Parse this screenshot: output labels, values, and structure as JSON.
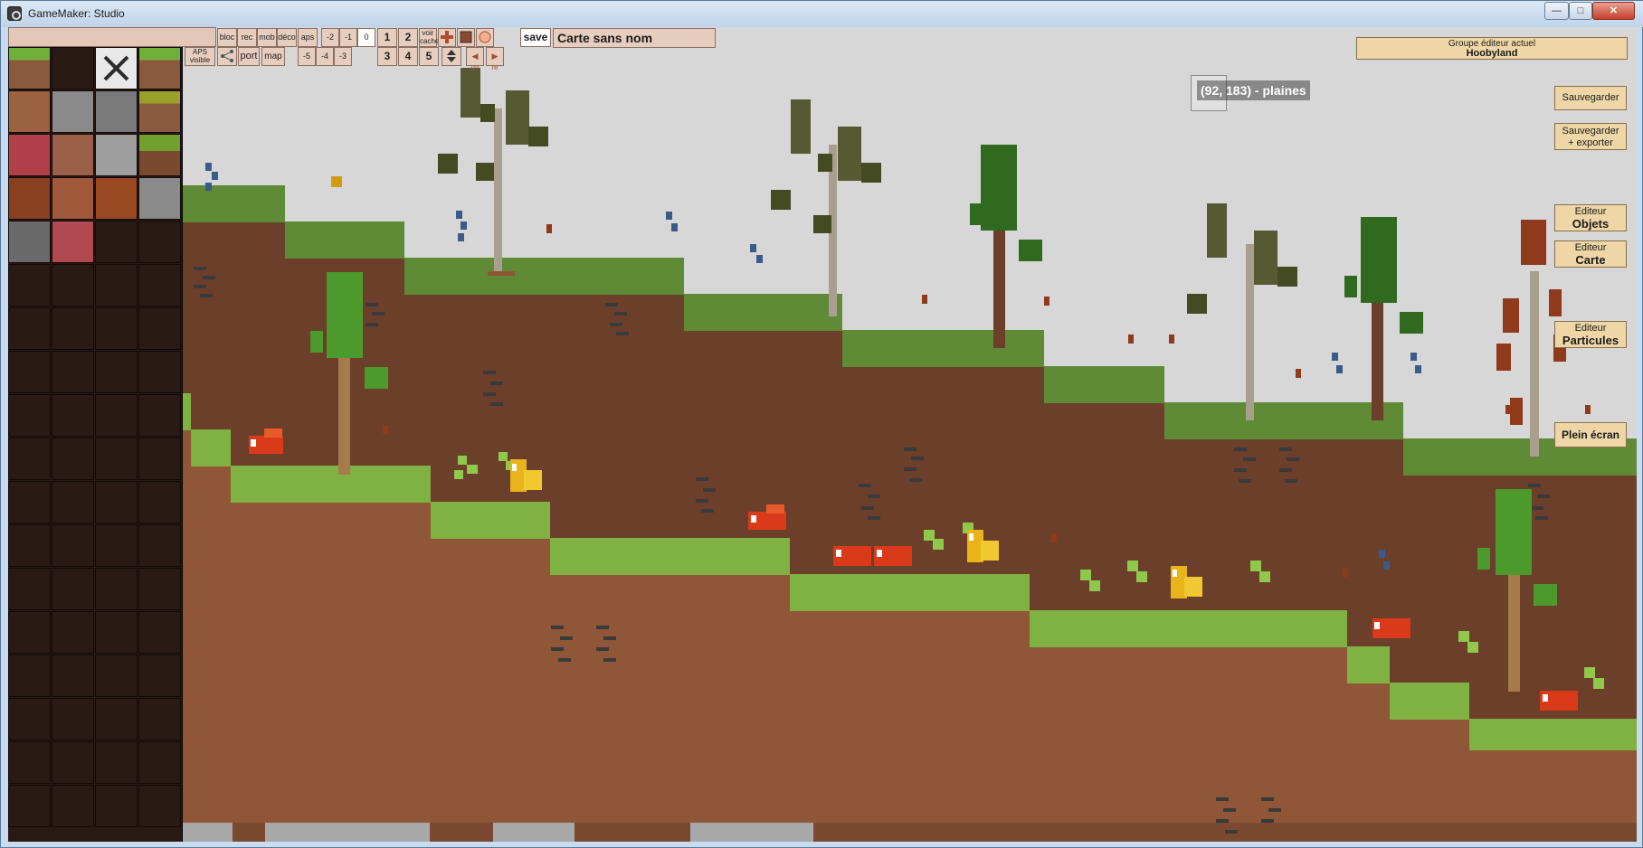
{
  "window": {
    "title": "GameMaker: Studio",
    "controls": {
      "minimize": "—",
      "maximize": "□",
      "close": "✕"
    }
  },
  "toolbar": {
    "row1": [
      "bloc",
      "rec",
      "mob",
      "déco",
      "aps",
      "-2",
      "-1",
      "0",
      "1",
      "2",
      "voir cache"
    ],
    "row2": [
      "APS visible",
      "port",
      "map",
      "-5",
      "-4",
      "-3",
      "3",
      "4",
      "5",
      "un",
      "re"
    ],
    "save": "save",
    "map_name": "Carte sans nom",
    "icons": [
      "dpad-icon",
      "square-icon",
      "circle-icon",
      "move-icon",
      "undo-icon",
      "redo-icon",
      "link-icon"
    ]
  },
  "map_cursor": {
    "label": "(92, 183) - plaines"
  },
  "right_panel": {
    "group_label": "Groupe éditeur actuel",
    "group_name": "Hoobyland",
    "save": "Sauvegarder",
    "save_export_1": "Sauvegarder",
    "save_export_2": "+ exporter",
    "editor_objects_1": "Editeur",
    "editor_objects_2": "Objets",
    "editor_map_1": "Editeur",
    "editor_map_2": "Carte",
    "editor_particles_1": "Editeur",
    "editor_particles_2": "Particules",
    "fullscreen": "Plein écran"
  },
  "colors": {
    "sky": "#d7d7d7",
    "dirt": "#6b3f2a",
    "dirt_light": "#8f5638",
    "grass_dark": "#5f8a36",
    "grass_light": "#7fb242",
    "button_bg": "#efd6a6",
    "palette_bg": "#2a1a16"
  }
}
